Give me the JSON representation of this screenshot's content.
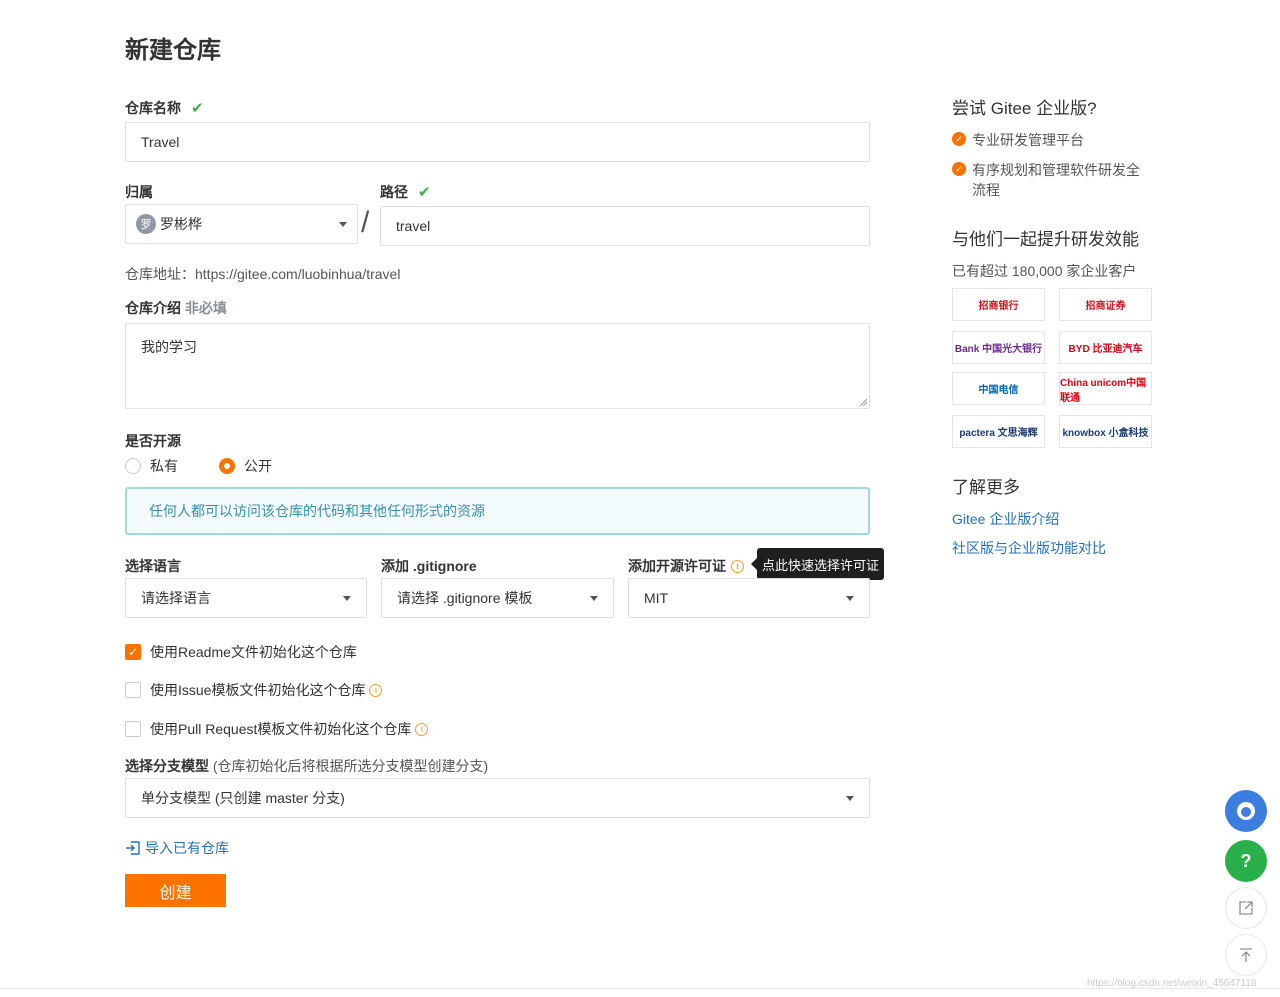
{
  "page": {
    "title": "新建仓库"
  },
  "repo_name": {
    "label": "仓库名称",
    "check": "✔",
    "value": "Travel"
  },
  "owner": {
    "label": "归属",
    "avatar_char": "罗",
    "value": "罗彬桦"
  },
  "path": {
    "label": "路径",
    "check": "✔",
    "separator": "/",
    "value": "travel"
  },
  "repo_url": {
    "text": "仓库地址：https://gitee.com/luobinhua/travel"
  },
  "intro": {
    "label": "仓库介绍",
    "optional": "非必填",
    "value": "我的学习"
  },
  "visibility": {
    "label": "是否开源",
    "options": [
      {
        "label": "私有",
        "selected": false
      },
      {
        "label": "公开",
        "selected": true
      }
    ],
    "notice": "任何人都可以访问该仓库的代码和其他任何形式的资源"
  },
  "language": {
    "label": "选择语言",
    "value": "请选择语言"
  },
  "gitignore": {
    "label": "添加 .gitignore",
    "value": "请选择 .gitignore 模板"
  },
  "license": {
    "label": "添加开源许可证",
    "value": "MIT",
    "tooltip": "点此快速选择许可证"
  },
  "init_options": [
    {
      "label": "使用Readme文件初始化这个仓库",
      "checked": true,
      "has_info": false
    },
    {
      "label": "使用Issue模板文件初始化这个仓库",
      "checked": false,
      "has_info": true
    },
    {
      "label": "使用Pull Request模板文件初始化这个仓库",
      "checked": false,
      "has_info": true
    }
  ],
  "branch_model": {
    "label": "选择分支模型",
    "note": "(仓库初始化后将根据所选分支模型创建分支)",
    "value": "单分支模型 (只创建 master 分支)"
  },
  "import_link": "导入已有仓库",
  "create_button": "创建",
  "sidebar": {
    "try_title": "尝试 Gitee 企业版?",
    "features": [
      "专业研发管理平台",
      "有序规划和管理软件研发全流程"
    ],
    "together_title": "与他们一起提升研发效能",
    "customers_text": "已有超过 180,000 家企业客户",
    "logos": [
      {
        "text": "招商银行",
        "color": "#c8161d"
      },
      {
        "text": "招商证券",
        "color": "#c8161d"
      },
      {
        "text": "Bank 中国光大银行",
        "color": "#6a2c8e"
      },
      {
        "text": "BYD 比亚迪汽车",
        "color": "#d0021b"
      },
      {
        "text": "中国电信",
        "color": "#0066b3"
      },
      {
        "text": "China unicom中国联通",
        "color": "#e60012"
      },
      {
        "text": "pactera 文思海辉",
        "color": "#1b3c78"
      },
      {
        "text": "knowbox 小盒科技",
        "color": "#1b3c78"
      }
    ],
    "learn_title": "了解更多",
    "links": [
      "Gitee 企业版介绍",
      "社区版与企业版功能对比"
    ]
  },
  "watermark": "https://blog.csdn.net/weixin_45647118",
  "colors": {
    "accent": "#fe7300",
    "success": "#3cae4a",
    "link": "#2a6fb8",
    "info_border": "#a3d8e3"
  }
}
